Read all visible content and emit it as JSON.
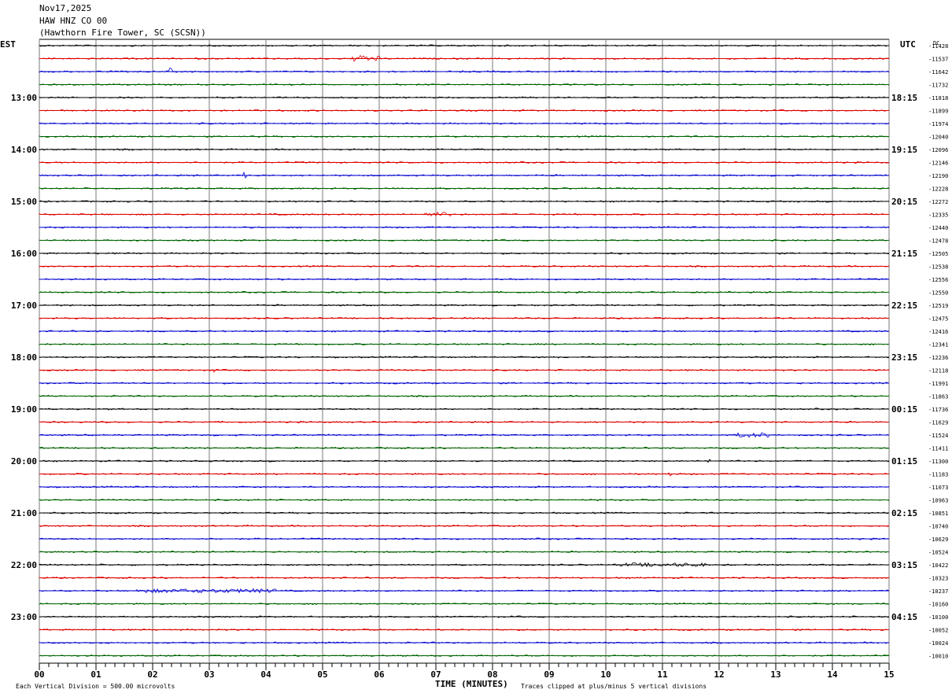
{
  "header": {
    "date": "Nov17,2025",
    "station": "HAW HNZ CO 00",
    "location": "(Hawthorn Fire Tower, SC (SCSN))"
  },
  "left_zone_label": "EST",
  "right_zone_label": "UTC",
  "dc_label": "DC",
  "footer": {
    "scale": "Each Vertical Division =  500.00 microvolts",
    "xlabel": "TIME (MINUTES)",
    "clip_note": "Traces clipped at plus/minus 5 vertical divisions"
  },
  "colors": {
    "black": "#000000",
    "red": "#e00000",
    "blue": "#0000d0",
    "green": "#006400",
    "grid": "#7a7a7a"
  },
  "chart_data": {
    "type": "line",
    "title": "",
    "xlabel": "TIME (MINUTES)",
    "xlim": [
      0,
      15
    ],
    "x_ticks": [
      "00",
      "01",
      "02",
      "03",
      "04",
      "05",
      "06",
      "07",
      "08",
      "09",
      "10",
      "11",
      "12",
      "13",
      "14",
      "15"
    ],
    "trace_count": 48,
    "trace_color_cycle": [
      "black",
      "red",
      "blue",
      "green"
    ],
    "left_hour_labels": [
      {
        "trace": 4,
        "label": "13:00"
      },
      {
        "trace": 8,
        "label": "14:00"
      },
      {
        "trace": 12,
        "label": "15:00"
      },
      {
        "trace": 16,
        "label": "16:00"
      },
      {
        "trace": 20,
        "label": "17:00"
      },
      {
        "trace": 24,
        "label": "18:00"
      },
      {
        "trace": 28,
        "label": "19:00"
      },
      {
        "trace": 32,
        "label": "20:00"
      },
      {
        "trace": 36,
        "label": "21:00"
      },
      {
        "trace": 40,
        "label": "22:00"
      },
      {
        "trace": 44,
        "label": "23:00"
      }
    ],
    "right_hour_labels": [
      {
        "trace": 4,
        "label": "18:15"
      },
      {
        "trace": 8,
        "label": "19:15"
      },
      {
        "trace": 12,
        "label": "20:15"
      },
      {
        "trace": 16,
        "label": "21:15"
      },
      {
        "trace": 20,
        "label": "22:15"
      },
      {
        "trace": 24,
        "label": "23:15"
      },
      {
        "trace": 28,
        "label": "00:15"
      },
      {
        "trace": 32,
        "label": "01:15"
      },
      {
        "trace": 36,
        "label": "02:15"
      },
      {
        "trace": 40,
        "label": "03:15"
      },
      {
        "trace": 44,
        "label": "04:15"
      }
    ],
    "dc_offsets": [
      "-11428",
      "-11537",
      "-11642",
      "-11732",
      "-11818",
      "-11899",
      "-11974",
      "-12040",
      "-12096",
      "-12146",
      "-12190",
      "-12228",
      "-12272",
      "-12335",
      "-12440",
      "-12478",
      "-12505",
      "-12538",
      "-12556",
      "-12550",
      "-12519",
      "-12475",
      "-12416",
      "-12341",
      "-12236",
      "-12118",
      "-11991",
      "-11863",
      "-11736",
      "-11629",
      "-11524",
      "-11411",
      "-11300",
      "-11183",
      "-11073",
      "-10963",
      "-10851",
      "-10740",
      "-10629",
      "-10524",
      "-10422",
      "-10323",
      "-10237",
      "-10160",
      "-10100",
      "-10052",
      "-10024",
      "-10010"
    ],
    "events": [
      {
        "trace": 1,
        "x_min": 5.5,
        "x_max": 6.0,
        "amp": 4
      },
      {
        "trace": 2,
        "x_min": 2.3,
        "x_max": 2.35,
        "amp": 5
      },
      {
        "trace": 10,
        "x_min": 3.55,
        "x_max": 3.65,
        "amp": 7
      },
      {
        "trace": 13,
        "x_min": 6.8,
        "x_max": 7.3,
        "amp": 3
      },
      {
        "trace": 25,
        "x_min": 3.05,
        "x_max": 3.1,
        "amp": 5
      },
      {
        "trace": 30,
        "x_min": 12.3,
        "x_max": 12.9,
        "amp": 3
      },
      {
        "trace": 32,
        "x_min": 11.8,
        "x_max": 11.85,
        "amp": 4
      },
      {
        "trace": 33,
        "x_min": 11.1,
        "x_max": 11.15,
        "amp": 4
      },
      {
        "trace": 40,
        "x_min": 10.2,
        "x_max": 11.8,
        "amp": 2.5
      },
      {
        "trace": 42,
        "x_min": 1.7,
        "x_max": 4.2,
        "amp": 2.5
      }
    ]
  }
}
